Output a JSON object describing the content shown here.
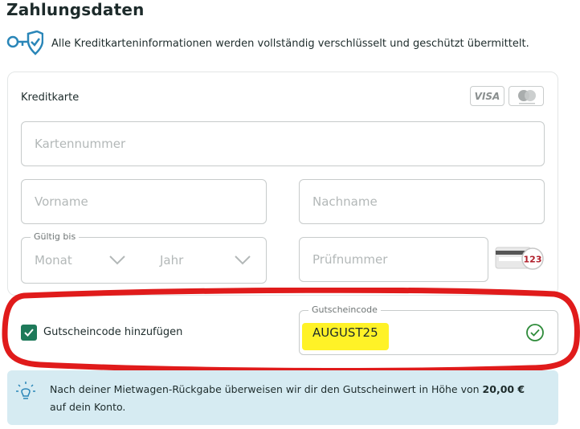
{
  "page": {
    "title": "Zahlungsdaten",
    "secure_note": "Alle Kreditkarteninformationen werden vollständig verschlüsselt und geschützt übermittelt."
  },
  "card_section": {
    "label": "Kreditkarte",
    "brand_visa": "VISA",
    "brand_mastercard_icon": "mastercard-logo",
    "card_number_placeholder": "Kartennummer",
    "first_name_placeholder": "Vorname",
    "last_name_placeholder": "Nachname",
    "expiry_legend": "Gültig bis",
    "expiry_month_placeholder": "Monat",
    "expiry_year_placeholder": "Jahr",
    "cvc_placeholder": "Prüfnummer",
    "cvc_hint_number": "123"
  },
  "voucher": {
    "checkbox_label": "Gutscheincode hinzufügen",
    "checked": true,
    "field_legend": "Gutscheincode",
    "value": "AUGUST25",
    "status_icon": "check-circle-icon"
  },
  "info": {
    "text_before": "Nach deiner Mietwagen-Rückgabe überweisen wir dir den Gutscheinwert in Höhe von ",
    "amount": "20,00 €",
    "text_after": " auf dein Konto."
  },
  "colors": {
    "accent_green": "#1e7a5a",
    "info_bg": "#d6ebf2",
    "highlight_yellow": "#fff227",
    "annotation_red": "#e01b1b",
    "icon_blue": "#2a86b8"
  }
}
